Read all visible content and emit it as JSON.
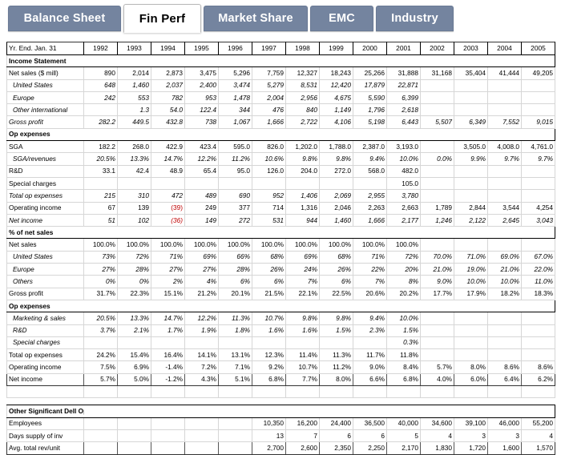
{
  "tabs": [
    {
      "label": "Balance Sheet",
      "active": false
    },
    {
      "label": "Fin Perf",
      "active": true
    },
    {
      "label": "Market Share",
      "active": false
    },
    {
      "label": "EMC",
      "active": false
    },
    {
      "label": "Industry",
      "active": false
    }
  ],
  "sheet": {
    "corner_label": "Yr. End. Jan. 31",
    "years": [
      "1992",
      "1993",
      "1994",
      "1995",
      "1996",
      "1997",
      "1998",
      "1999",
      "2000",
      "2001",
      "2002",
      "2003",
      "2004",
      "2005"
    ],
    "sections": [
      {
        "title": "Income Statement"
      },
      {
        "title": "Op expenses"
      },
      {
        "title": "% of net sales"
      },
      {
        "title": "Other Significant Dell Operating Statistics"
      }
    ],
    "rows": [
      {
        "type": "section",
        "label": "Income Statement"
      },
      {
        "type": "data",
        "label": "Net sales ($ mill)",
        "style": "plain",
        "values": [
          "890",
          "2,014",
          "2,873",
          "3,475",
          "5,296",
          "7,759",
          "12,327",
          "18,243",
          "25,266",
          "31,888",
          "31,168",
          "35,404",
          "41,444",
          "49,205"
        ]
      },
      {
        "type": "data",
        "label": "United States",
        "style": "italic-indent1",
        "values": [
          "648",
          "1,460",
          "2,037",
          "2,400",
          "3,474",
          "5,279",
          "8,531",
          "12,420",
          "17,879",
          "22,871",
          "",
          "",
          "",
          ""
        ]
      },
      {
        "type": "data",
        "label": "Europe",
        "style": "italic-indent1",
        "values": [
          "242",
          "553",
          "782",
          "953",
          "1,478",
          "2,004",
          "2,956",
          "4,675",
          "5,590",
          "6,399",
          "",
          "",
          "",
          ""
        ]
      },
      {
        "type": "data",
        "label": "Other international",
        "style": "italic-indent1",
        "values": [
          "",
          "1.3",
          "54.0",
          "122.4",
          "344",
          "476",
          "840",
          "1,149",
          "1,796",
          "2,618",
          "",
          "",
          "",
          ""
        ]
      },
      {
        "type": "data",
        "label": "Gross profit",
        "style": "italic",
        "values": [
          "282.2",
          "449.5",
          "432.8",
          "738",
          "1,067",
          "1,666",
          "2,722",
          "4,106",
          "5,198",
          "6,443",
          "5,507",
          "6,349",
          "7,552",
          "9,015"
        ]
      },
      {
        "type": "section",
        "label": "Op expenses"
      },
      {
        "type": "data",
        "label": "SGA",
        "style": "plain",
        "values": [
          "182.2",
          "268.0",
          "422.9",
          "423.4",
          "595.0",
          "826.0",
          "1,202.0",
          "1,788.0",
          "2,387.0",
          "3,193.0",
          "",
          "3,505.0",
          "4,008.0",
          "4,761.0"
        ]
      },
      {
        "type": "data",
        "label": "SGA/revenues",
        "style": "italic-indent1",
        "values": [
          "20.5%",
          "13.3%",
          "14.7%",
          "12.2%",
          "11.2%",
          "10.6%",
          "9.8%",
          "9.8%",
          "9.4%",
          "10.0%",
          "0.0%",
          "9.9%",
          "9.7%",
          "9.7%"
        ]
      },
      {
        "type": "data",
        "label": "R&D",
        "style": "plain",
        "values": [
          "33.1",
          "42.4",
          "48.9",
          "65.4",
          "95.0",
          "126.0",
          "204.0",
          "272.0",
          "568.0",
          "482.0",
          "",
          "",
          "",
          ""
        ]
      },
      {
        "type": "data",
        "label": "Special charges",
        "style": "plain",
        "values": [
          "",
          "",
          "",
          "",
          "",
          "",
          "",
          "",
          "",
          "105.0",
          "",
          "",
          "",
          ""
        ]
      },
      {
        "type": "data",
        "label": "Total op expenses",
        "style": "italic",
        "values": [
          "215",
          "310",
          "472",
          "489",
          "690",
          "952",
          "1,406",
          "2,069",
          "2,955",
          "3,780",
          "",
          "",
          "",
          ""
        ]
      },
      {
        "type": "data",
        "label": "Operating income",
        "style": "plain",
        "values": [
          "67",
          "139",
          "(39)",
          "249",
          "377",
          "714",
          "1,316",
          "2,046",
          "2,263",
          "2,663",
          "1,789",
          "2,844",
          "3,544",
          "4,254"
        ],
        "negatives": [
          2
        ]
      },
      {
        "type": "data",
        "label": "Net income",
        "style": "italic",
        "values": [
          "51",
          "102",
          "(36)",
          "149",
          "272",
          "531",
          "944",
          "1,460",
          "1,666",
          "2,177",
          "1,246",
          "2,122",
          "2,645",
          "3,043"
        ],
        "negatives": [
          2
        ]
      },
      {
        "type": "section",
        "label": "% of net sales"
      },
      {
        "type": "data",
        "label": "Net sales",
        "style": "plain",
        "values": [
          "100.0%",
          "100.0%",
          "100.0%",
          "100.0%",
          "100.0%",
          "100.0%",
          "100.0%",
          "100.0%",
          "100.0%",
          "100.0%",
          "",
          "",
          "",
          ""
        ]
      },
      {
        "type": "data",
        "label": "United States",
        "style": "italic-indent1",
        "values": [
          "73%",
          "72%",
          "71%",
          "69%",
          "66%",
          "68%",
          "69%",
          "68%",
          "71%",
          "72%",
          "70.0%",
          "71.0%",
          "69.0%",
          "67.0%"
        ]
      },
      {
        "type": "data",
        "label": "Europe",
        "style": "italic-indent1",
        "values": [
          "27%",
          "28%",
          "27%",
          "27%",
          "28%",
          "26%",
          "24%",
          "26%",
          "22%",
          "20%",
          "21.0%",
          "19.0%",
          "21.0%",
          "22.0%"
        ]
      },
      {
        "type": "data",
        "label": "Others",
        "style": "italic-indent1",
        "values": [
          "0%",
          "0%",
          "2%",
          "4%",
          "6%",
          "6%",
          "7%",
          "6%",
          "7%",
          "8%",
          "9.0%",
          "10.0%",
          "10.0%",
          "11.0%"
        ]
      },
      {
        "type": "data",
        "label": "Gross profit",
        "style": "plain",
        "values": [
          "31.7%",
          "22.3%",
          "15.1%",
          "21.2%",
          "20.1%",
          "21.5%",
          "22.1%",
          "22.5%",
          "20.6%",
          "20.2%",
          "17.7%",
          "17.9%",
          "18.2%",
          "18.3%"
        ]
      },
      {
        "type": "section",
        "label": "Op expenses"
      },
      {
        "type": "data",
        "label": "Marketing & sales",
        "style": "italic-indent1",
        "values": [
          "20.5%",
          "13.3%",
          "14.7%",
          "12.2%",
          "11.3%",
          "10.7%",
          "9.8%",
          "9.8%",
          "9.4%",
          "10.0%",
          "",
          "",
          "",
          ""
        ]
      },
      {
        "type": "data",
        "label": "R&D",
        "style": "italic-indent1",
        "values": [
          "3.7%",
          "2.1%",
          "1.7%",
          "1.9%",
          "1.8%",
          "1.6%",
          "1.6%",
          "1.5%",
          "2.3%",
          "1.5%",
          "",
          "",
          "",
          ""
        ]
      },
      {
        "type": "data",
        "label": "Special charges",
        "style": "italic-indent1",
        "values": [
          "",
          "",
          "",
          "",
          "",
          "",
          "",
          "",
          "",
          "0.3%",
          "",
          "",
          "",
          ""
        ]
      },
      {
        "type": "data",
        "label": "Total op expenses",
        "style": "plain",
        "values": [
          "24.2%",
          "15.4%",
          "16.4%",
          "14.1%",
          "13.1%",
          "12.3%",
          "11.4%",
          "11.3%",
          "11.7%",
          "11.8%",
          "",
          "",
          "",
          ""
        ]
      },
      {
        "type": "data",
        "label": "Operating income",
        "style": "plain",
        "values": [
          "7.5%",
          "6.9%",
          "-1.4%",
          "7.2%",
          "7.1%",
          "9.2%",
          "10.7%",
          "11.2%",
          "9.0%",
          "8.4%",
          "5.7%",
          "8.0%",
          "8.6%",
          "8.6%"
        ]
      },
      {
        "type": "data",
        "label": "Net income",
        "style": "plain-emph",
        "values": [
          "5.7%",
          "5.0%",
          "-1.2%",
          "4.3%",
          "5.1%",
          "6.8%",
          "7.7%",
          "8.0%",
          "6.6%",
          "6.8%",
          "4.0%",
          "6.0%",
          "6.4%",
          "6.2%"
        ]
      },
      {
        "type": "blank"
      },
      {
        "type": "gap"
      },
      {
        "type": "section",
        "label": "Other Significant Dell Operating Statistics"
      },
      {
        "type": "data",
        "label": "Employees",
        "style": "plain",
        "values": [
          "",
          "",
          "",
          "",
          "",
          "10,350",
          "16,200",
          "24,400",
          "36,500",
          "40,000",
          "34,600",
          "39,100",
          "46,000",
          "55,200"
        ]
      },
      {
        "type": "data",
        "label": "Days supply of inv",
        "style": "plain",
        "values": [
          "",
          "",
          "",
          "",
          "",
          "13",
          "7",
          "6",
          "6",
          "5",
          "4",
          "3",
          "3",
          "4"
        ]
      },
      {
        "type": "data",
        "label": "Avg. total rev/unit",
        "style": "plain-emph",
        "values": [
          "",
          "",
          "",
          "",
          "",
          "2,700",
          "2,600",
          "2,350",
          "2,250",
          "2,170",
          "1,830",
          "1,720",
          "1,600",
          "1,570"
        ]
      }
    ]
  },
  "colors": {
    "tab_inactive_bg": "#74849f",
    "tab_active_bg": "#ffffff",
    "tab_inactive_text": "#ffffff",
    "negative_value": "#c00000",
    "grid_line": "#d6d6d6",
    "heavy_line": "#333333"
  }
}
